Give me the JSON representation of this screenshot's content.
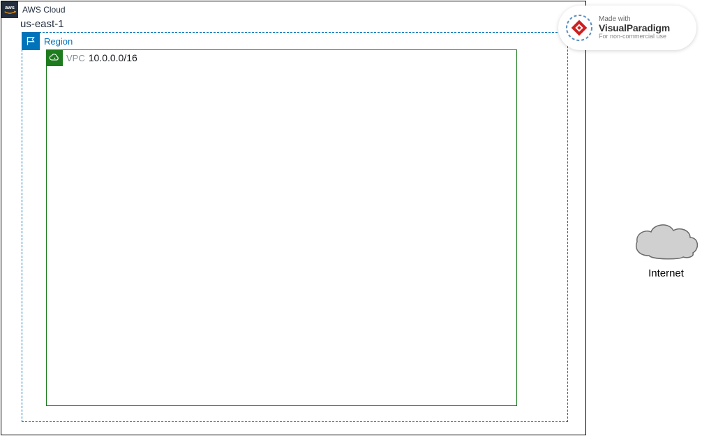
{
  "cloud": {
    "label": "AWS Cloud",
    "subtitle": "us-east-1"
  },
  "region": {
    "label": "Region"
  },
  "vpc": {
    "label": "VPC",
    "cidr": "10.0.0.0/16"
  },
  "internet": {
    "label": "Internet"
  },
  "watermark": {
    "line1": "Made with",
    "brand_a": "Visual",
    "brand_b": "Paradigm",
    "line3": "For non-commercial use"
  },
  "colors": {
    "aws_bg": "#232f3e",
    "aws_accent": "#ff9900",
    "region": "#0073bb",
    "vpc": "#1e7b1e"
  }
}
